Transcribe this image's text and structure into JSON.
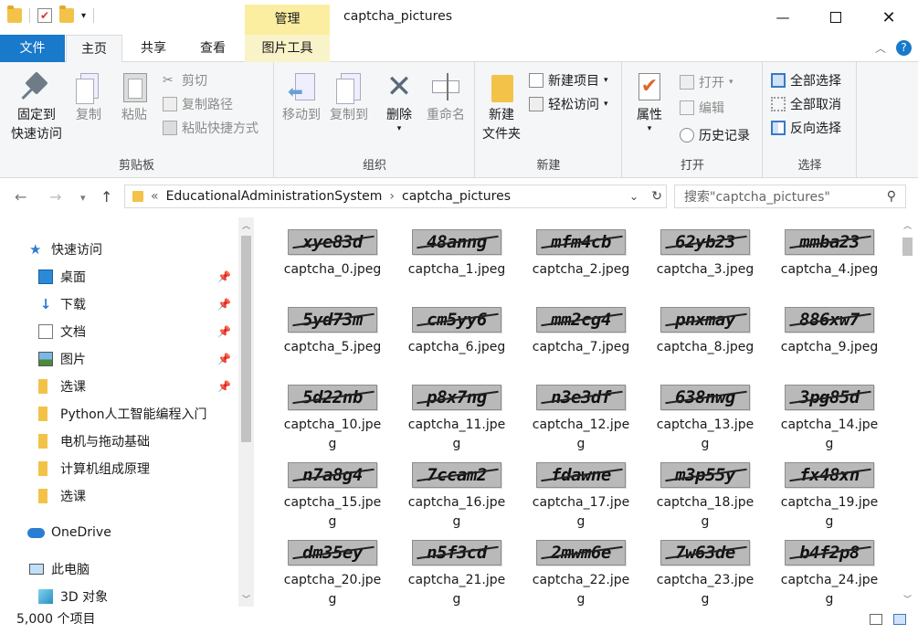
{
  "window": {
    "title": "captcha_pictures",
    "context_tab": "管理"
  },
  "menu": {
    "file": "文件",
    "home": "主页",
    "share": "共享",
    "view": "查看",
    "picture_tools": "图片工具"
  },
  "ribbon": {
    "clipboard": {
      "pin_label": "固定到\n快速访问",
      "copy": "复制",
      "paste": "粘贴",
      "cut": "剪切",
      "copy_path": "复制路径",
      "paste_shortcut": "粘贴快捷方式",
      "group": "剪贴板"
    },
    "organize": {
      "move_to": "移动到",
      "copy_to": "复制到",
      "delete": "删除",
      "rename": "重命名",
      "group": "组织"
    },
    "new": {
      "new_folder": "新建\n文件夹",
      "new_item": "新建项目",
      "easy_access": "轻松访问",
      "group": "新建"
    },
    "open": {
      "properties": "属性",
      "open": "打开",
      "edit": "编辑",
      "history": "历史记录",
      "group": "打开"
    },
    "select": {
      "select_all": "全部选择",
      "select_none": "全部取消",
      "invert": "反向选择",
      "group": "选择"
    }
  },
  "address": {
    "prefix": "«",
    "crumb1": "EducationalAdministrationSystem",
    "sep": "›",
    "crumb2": "captcha_pictures",
    "search_placeholder": "搜索\"captcha_pictures\""
  },
  "nav": {
    "quick_access": "快速访问",
    "desktop": "桌面",
    "downloads": "下载",
    "documents": "文档",
    "pictures": "图片",
    "folder1": "选课",
    "folder2": "Python人工智能编程入门",
    "folder3": "电机与拖动基础",
    "folder4": "计算机组成原理",
    "folder5": "选课",
    "onedrive": "OneDrive",
    "this_pc": "此电脑",
    "objects3d": "3D 对象"
  },
  "files": [
    {
      "name": "captcha_0.jpeg",
      "code": "xye83d"
    },
    {
      "name": "captcha_1.jpeg",
      "code": "48anng"
    },
    {
      "name": "captcha_2.jpeg",
      "code": "mfm4cb"
    },
    {
      "name": "captcha_3.jpeg",
      "code": "62yb23"
    },
    {
      "name": "captcha_4.jpeg",
      "code": "mmba23"
    },
    {
      "name": "captcha_5.jpeg",
      "code": "5yd73m"
    },
    {
      "name": "captcha_6.jpeg",
      "code": "cm5yy6"
    },
    {
      "name": "captcha_7.jpeg",
      "code": "mm2cg4"
    },
    {
      "name": "captcha_8.jpeg",
      "code": "pnxmay"
    },
    {
      "name": "captcha_9.jpeg",
      "code": "886xw7"
    },
    {
      "name": "captcha_10.jpeg",
      "code": "5d22nb"
    },
    {
      "name": "captcha_11.jpeg",
      "code": "p8x7ng"
    },
    {
      "name": "captcha_12.jpeg",
      "code": "n3e3df"
    },
    {
      "name": "captcha_13.jpeg",
      "code": "638nwg"
    },
    {
      "name": "captcha_14.jpeg",
      "code": "3pg85d"
    },
    {
      "name": "captcha_15.jpeg",
      "code": "n7a8g4"
    },
    {
      "name": "captcha_16.jpeg",
      "code": "7ccam2"
    },
    {
      "name": "captcha_17.jpeg",
      "code": "fdawne"
    },
    {
      "name": "captcha_18.jpeg",
      "code": "m3p55y"
    },
    {
      "name": "captcha_19.jpeg",
      "code": "fx48xn"
    },
    {
      "name": "captcha_20.jpeg",
      "code": "dm35ey"
    },
    {
      "name": "captcha_21.jpeg",
      "code": "n5f3cd"
    },
    {
      "name": "captcha_22.jpeg",
      "code": "2mwm6e"
    },
    {
      "name": "captcha_23.jpeg",
      "code": "7w63de"
    },
    {
      "name": "captcha_24.jpeg",
      "code": "b4f2p8"
    }
  ],
  "status": {
    "item_count": "5,000 个项目"
  },
  "colors": {
    "file_tab": "#1979ca",
    "context_tab": "#fbeea0",
    "folder": "#f3c349"
  }
}
